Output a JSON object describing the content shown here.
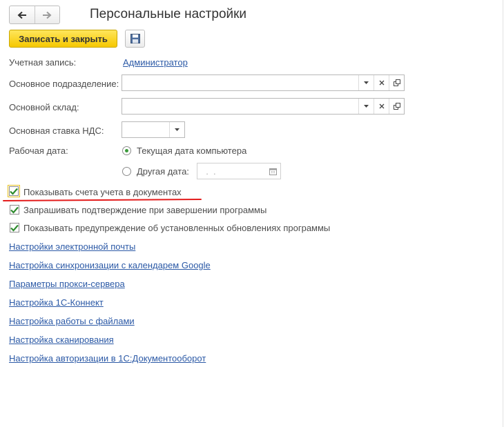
{
  "window": {
    "title": "Персональные настройки"
  },
  "toolbar": {
    "save_close_label": "Записать и закрыть"
  },
  "form": {
    "account_label": "Учетная запись:",
    "account_value": "Администратор",
    "department_label": "Основное подразделение:",
    "department_value": "",
    "warehouse_label": "Основной склад:",
    "warehouse_value": "",
    "vat_label": "Основная ставка НДС:",
    "vat_value": "",
    "workdate_label": "Рабочая дата:",
    "radio_current": "Текущая дата компьютера",
    "radio_other": "Другая дата:",
    "other_date_placeholder": "  .  .    ",
    "selected_radio": "current"
  },
  "checkboxes": [
    {
      "label": "Показывать счета учета в документах",
      "checked": true
    },
    {
      "label": "Запрашивать подтверждение при завершении программы",
      "checked": true
    },
    {
      "label": "Показывать предупреждение об установленных обновлениях программы",
      "checked": true
    }
  ],
  "links": [
    "Настройки электронной почты",
    "Настройка синхронизации с календарем Google",
    "Параметры прокси-сервера",
    "Настройка 1С-Коннект",
    "Настройка работы с файлами",
    "Настройка сканирования",
    "Настройка авторизации в 1С:Документооборот"
  ],
  "colors": {
    "primary_button": "#f6c800",
    "link": "#2b59a6",
    "checkmark": "#2e8b2e",
    "annotation_underline": "#e31b1b"
  }
}
